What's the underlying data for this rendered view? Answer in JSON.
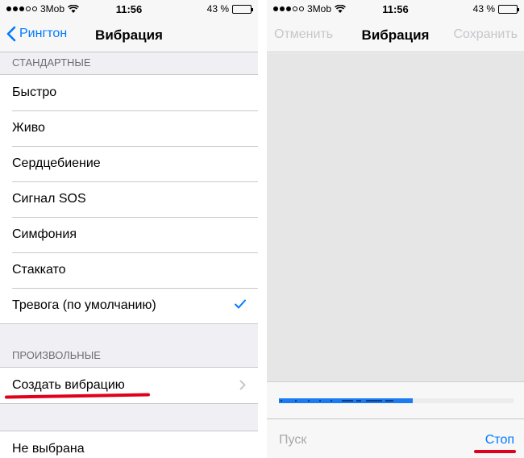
{
  "left": {
    "status": {
      "carrier": "3Mob",
      "time": "11:56",
      "battery": "43 %"
    },
    "nav": {
      "back_label": "Рингтон",
      "title": "Вибрация"
    },
    "standard_header": "СТАНДАРТНЫЕ",
    "standard_items": [
      {
        "label": "Быстро"
      },
      {
        "label": "Живо"
      },
      {
        "label": "Сердцебиение"
      },
      {
        "label": "Сигнал SOS"
      },
      {
        "label": "Симфония"
      },
      {
        "label": "Стаккато"
      },
      {
        "label": "Тревога (по умолчанию)",
        "selected": true
      }
    ],
    "custom_header": "ПРОИЗВОЛЬНЫЕ",
    "custom_items": [
      {
        "label": "Создать вибрацию"
      }
    ],
    "none_item": "Не выбрана"
  },
  "right": {
    "status": {
      "carrier": "3Mob",
      "time": "11:56",
      "battery": "43 %"
    },
    "nav": {
      "cancel_label": "Отменить",
      "title": "Вибрация",
      "save_label": "Сохранить"
    },
    "playback_progress": 0.57,
    "toolbar": {
      "play_label": "Пуск",
      "stop_label": "Стоп"
    }
  },
  "colors": {
    "accent": "#007aff",
    "highlight": "#e0001b",
    "progress": "#1a7cf0"
  },
  "icons": [
    "wifi-icon",
    "battery-icon",
    "chevron-left-icon",
    "checkmark-icon",
    "chevron-right-icon"
  ]
}
